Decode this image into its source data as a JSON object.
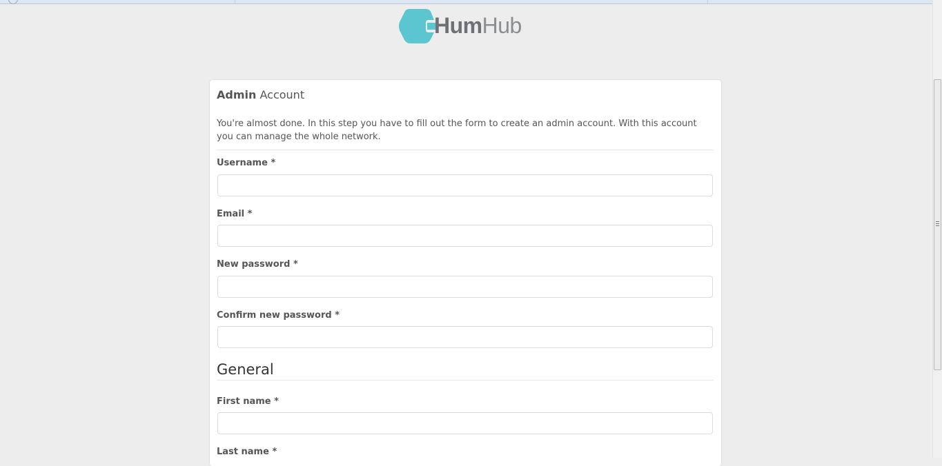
{
  "logo": {
    "text_bold": "Hum",
    "text_light": "Hub",
    "brand_color": "#5bc5d0"
  },
  "panel": {
    "title_bold": "Admin",
    "title_light": "Account",
    "intro": "You're almost done. In this step you have to fill out the form to create an admin account. With this account you can manage the whole network."
  },
  "form": {
    "username_label": "Username *",
    "username_value": "",
    "email_label": "Email *",
    "email_value": "",
    "password_label": "New password *",
    "password_value": "",
    "confirm_password_label": "Confirm new password *",
    "confirm_password_value": "",
    "general_heading": "General",
    "firstname_label": "First name *",
    "firstname_value": "",
    "lastname_label": "Last name *"
  }
}
